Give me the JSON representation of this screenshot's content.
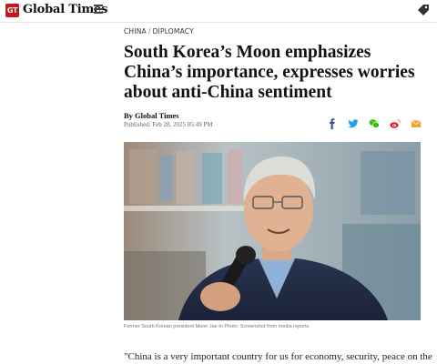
{
  "site": {
    "logo_badge": "GT",
    "logo_text": "Global Times"
  },
  "icons": {
    "menu": "hamburger-menu-icon",
    "tag": "tag-icon",
    "share": [
      "facebook-icon",
      "twitter-icon",
      "wechat-icon",
      "weibo-icon",
      "email-icon"
    ]
  },
  "colors": {
    "brand_red": "#c4161c",
    "facebook": "#3b5998",
    "twitter": "#1da1f2",
    "wechat": "#2dc100",
    "weibo": "#e6162d",
    "email": "#f0a030"
  },
  "article": {
    "breadcrumb": [
      "CHINA",
      "DIPLOMACY"
    ],
    "breadcrumb_sep": "/",
    "headline": "South Korea’s Moon emphasizes China’s importance, expresses worries about anti-China sentiment",
    "byline": "By Global Times",
    "published": "Published: Feb 28, 2025 05:49 PM",
    "caption": "Former South Korean president Moon Jae-in Photo: Screenshot from media reports",
    "body_start": "\"China is a very important country for us for economy, security, peace on the"
  }
}
